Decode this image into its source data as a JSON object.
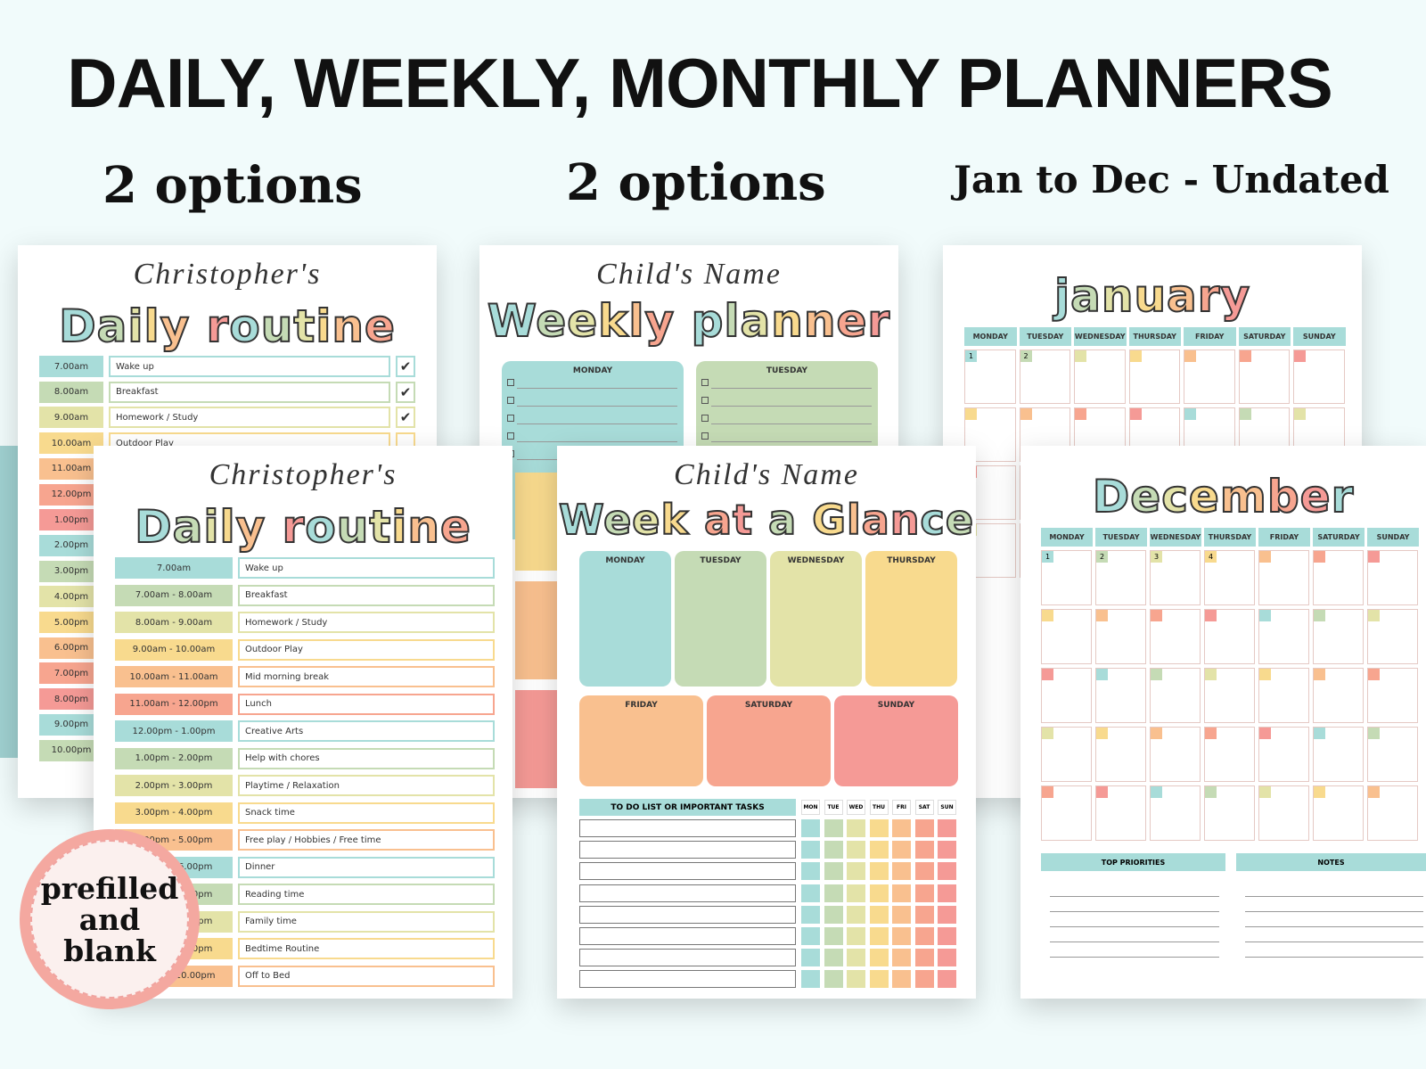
{
  "header": {
    "title": "DAILY, WEEKLY, MONTHLY PLANNERS",
    "daily_sub": "2 options",
    "weekly_sub": "2 options",
    "monthly_sub": "Jan to Dec - Undated"
  },
  "colors": {
    "teal": "#a8dcd9",
    "green": "#c5dbb5",
    "yellowgreen": "#e3e3a8",
    "yellow": "#f8da8e",
    "orange": "#f9c08f",
    "salmon": "#f7a58f",
    "pink": "#f59a96"
  },
  "daily_back": {
    "name": "Christopher's",
    "title": "Daily routine",
    "rows": [
      {
        "time": "7.00am",
        "task": "Wake up",
        "check": "✔",
        "color": "teal"
      },
      {
        "time": "8.00am",
        "task": "Breakfast",
        "check": "✔",
        "color": "green"
      },
      {
        "time": "9.00am",
        "task": "Homework / Study",
        "check": "✔",
        "color": "yellowgreen"
      },
      {
        "time": "10.00am",
        "task": "Outdoor Play",
        "check": "",
        "color": "yellow"
      },
      {
        "time": "11.00am",
        "task": "",
        "check": "",
        "color": "orange"
      },
      {
        "time": "12.00pm",
        "task": "",
        "check": "",
        "color": "salmon"
      },
      {
        "time": "1.00pm",
        "task": "",
        "check": "",
        "color": "pink"
      },
      {
        "time": "2.00pm",
        "task": "",
        "check": "",
        "color": "teal"
      },
      {
        "time": "3.00pm",
        "task": "",
        "check": "",
        "color": "green"
      },
      {
        "time": "4.00pm",
        "task": "",
        "check": "",
        "color": "yellowgreen"
      },
      {
        "time": "5.00pm",
        "task": "",
        "check": "",
        "color": "yellow"
      },
      {
        "time": "6.00pm",
        "task": "",
        "check": "",
        "color": "orange"
      },
      {
        "time": "7.00pm",
        "task": "",
        "check": "",
        "color": "salmon"
      },
      {
        "time": "8.00pm",
        "task": "",
        "check": "",
        "color": "pink"
      },
      {
        "time": "9.00pm",
        "task": "",
        "check": "",
        "color": "teal"
      },
      {
        "time": "10.00pm",
        "task": "",
        "check": "",
        "color": "green"
      }
    ]
  },
  "daily_front": {
    "name": "Christopher's",
    "title": "Daily routine",
    "rows": [
      {
        "time": "7.00am",
        "task": "Wake up",
        "color": "teal"
      },
      {
        "time": "7.00am - 8.00am",
        "task": "Breakfast",
        "color": "green"
      },
      {
        "time": "8.00am - 9.00am",
        "task": "Homework / Study",
        "color": "yellowgreen"
      },
      {
        "time": "9.00am - 10.00am",
        "task": "Outdoor Play",
        "color": "yellow"
      },
      {
        "time": "10.00am - 11.00am",
        "task": "Mid morning break",
        "color": "orange"
      },
      {
        "time": "11.00am - 12.00pm",
        "task": "Lunch",
        "color": "salmon"
      },
      {
        "time": "12.00pm - 1.00pm",
        "task": "Creative Arts",
        "color": "teal"
      },
      {
        "time": "1.00pm - 2.00pm",
        "task": "Help with chores",
        "color": "green"
      },
      {
        "time": "2.00pm - 3.00pm",
        "task": "Playtime / Relaxation",
        "color": "yellowgreen"
      },
      {
        "time": "3.00pm - 4.00pm",
        "task": "Snack time",
        "color": "yellow"
      },
      {
        "time": "4.00pm - 5.00pm",
        "task": "Free play / Hobbies / Free time",
        "color": "orange"
      },
      {
        "time": "5.00pm - 6.00pm",
        "task": "Dinner",
        "color": "teal"
      },
      {
        "time": "6.00pm - 7.00pm",
        "task": "Reading time",
        "color": "green"
      },
      {
        "time": "7.00pm - 8.00pm",
        "task": "Family time",
        "color": "yellowgreen"
      },
      {
        "time": "8.00pm - 9.00pm",
        "task": "Bedtime Routine",
        "color": "yellow"
      },
      {
        "time": "9.00pm - 10.00pm",
        "task": "Off to Bed",
        "color": "orange"
      }
    ]
  },
  "weekly_back": {
    "name": "Child's Name",
    "title": "Weekly planner",
    "days": [
      "MONDAY",
      "TUESDAY"
    ]
  },
  "week_glance": {
    "name": "Child's Name",
    "title": "Week at a Glance",
    "days_top": [
      "MONDAY",
      "TUESDAY",
      "WEDNESDAY",
      "THURSDAY"
    ],
    "days_bottom": [
      "FRIDAY",
      "SATURDAY",
      "SUNDAY"
    ],
    "todo_header": "TO DO LIST OR IMPORTANT TASKS",
    "day_abbr": [
      "MON",
      "TUE",
      "WED",
      "THU",
      "FRI",
      "SAT",
      "SUN"
    ]
  },
  "january": {
    "title": "january",
    "weekdays": [
      "MONDAY",
      "TUESDAY",
      "WEDNESDAY",
      "THURSDAY",
      "FRIDAY",
      "SATURDAY",
      "SUNDAY"
    ],
    "dates": [
      "1",
      "2"
    ]
  },
  "december": {
    "title": "December",
    "weekdays": [
      "MONDAY",
      "TUESDAY",
      "WEDNESDAY",
      "THURSDAY",
      "FRIDAY",
      "SATURDAY",
      "SUNDAY"
    ],
    "dates": [
      "1",
      "2",
      "3",
      "4"
    ],
    "priorities": "TOP PRIORITIES",
    "notes": "NOTES"
  },
  "badge": {
    "line1": "prefilled",
    "line2": "and",
    "line3": "blank"
  }
}
